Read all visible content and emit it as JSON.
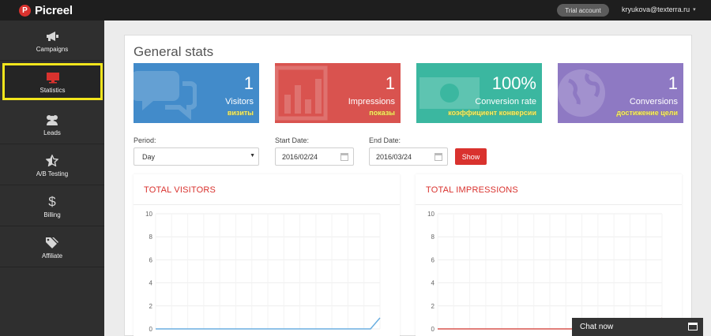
{
  "header": {
    "logo_letter": "P",
    "logo_text": "Picreel",
    "trial_label": "Trial account",
    "user_email": "kryukova@texterra.ru"
  },
  "sidebar": {
    "items": [
      {
        "label": "Campaigns",
        "icon": "megaphone-icon"
      },
      {
        "label": "Statistics",
        "icon": "monitor-icon",
        "active": true
      },
      {
        "label": "Leads",
        "icon": "users-icon"
      },
      {
        "label": "A/B Testing",
        "icon": "star-half-icon"
      },
      {
        "label": "Billing",
        "icon": "dollar-icon"
      },
      {
        "label": "Affiliate",
        "icon": "tags-icon"
      }
    ]
  },
  "main": {
    "title": "General stats",
    "cards": [
      {
        "value": "1",
        "label": "Visitors",
        "translation": "визиты",
        "color": "#428bca",
        "icon": "comments-icon"
      },
      {
        "value": "1",
        "label": "Impressions",
        "translation": "показы",
        "color": "#d9534f",
        "icon": "bar-chart-icon"
      },
      {
        "value": "100%",
        "label": "Conversion rate",
        "translation": "коэффициент конверсии",
        "color": "#3bb7a0",
        "icon": "money-icon"
      },
      {
        "value": "1",
        "label": "Conversions",
        "translation": "достижение цели",
        "color": "#8e79c3",
        "icon": "globe-icon"
      }
    ],
    "filters": {
      "period_label": "Period:",
      "period_value": "Day",
      "start_label": "Start Date:",
      "start_value": "2016/02/24",
      "end_label": "End Date:",
      "end_value": "2016/03/24",
      "show_label": "Show"
    },
    "charts": [
      {
        "title": "TOTAL VISITORS",
        "line_color": "#6aaee0",
        "y_ticks": [
          "10",
          "8",
          "6",
          "4",
          "2",
          "0"
        ]
      },
      {
        "title": "TOTAL IMPRESSIONS",
        "line_color": "#d9534f",
        "y_ticks": [
          "10",
          "8",
          "6",
          "4",
          "2",
          "0"
        ]
      }
    ]
  },
  "chat": {
    "label": "Chat now"
  }
}
